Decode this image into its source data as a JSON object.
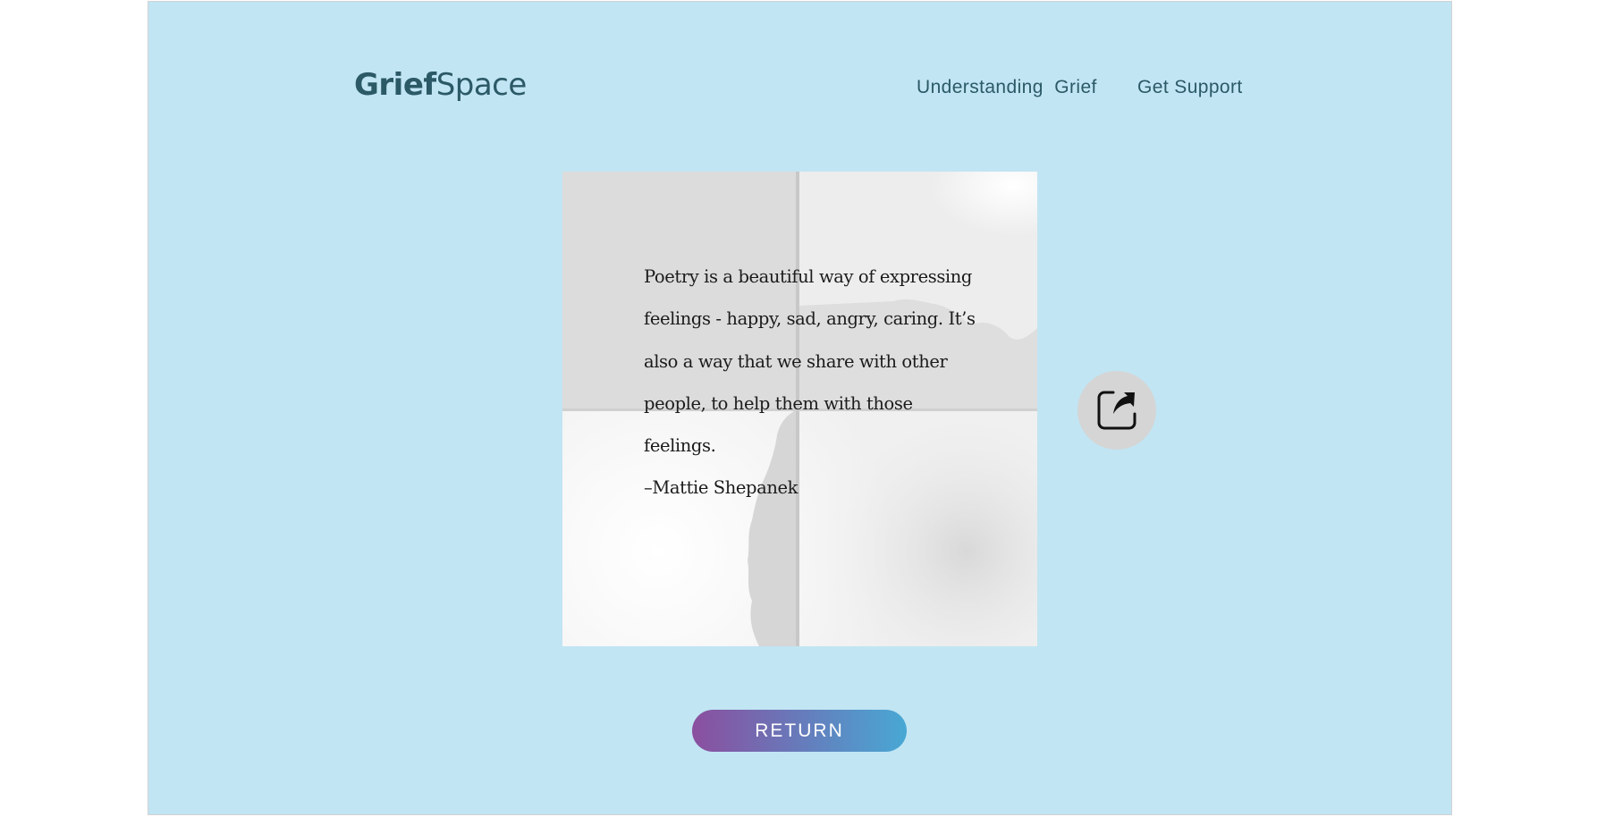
{
  "header": {
    "logo_bold": "Grief",
    "logo_light": "Space",
    "nav": [
      {
        "label": "Understanding  Grief"
      },
      {
        "label": "Get Support"
      }
    ]
  },
  "poem_card": {
    "quote_lines": [
      "Poetry is a beautiful way of expressing",
      "feelings - happy, sad, angry, caring. It’s",
      "also a way that we share with other",
      "people, to help them with those",
      "feelings."
    ],
    "author": "–Mattie Shepanek"
  },
  "share_button": {
    "icon": "share-icon"
  },
  "return_button": {
    "label": "RETURN"
  },
  "colors": {
    "page_background": "#c1e5f3",
    "brand_text": "#2c5966",
    "return_gradient_start": "#8b4f9f",
    "return_gradient_end": "#48a8d4",
    "share_button_bg": "#d5d5d5"
  }
}
